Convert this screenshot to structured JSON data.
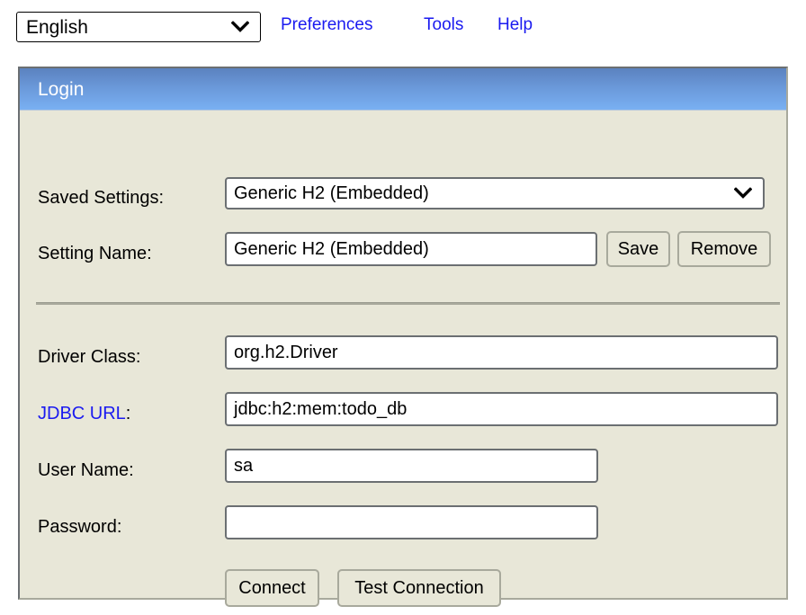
{
  "toolbar": {
    "language_select": {
      "value": "English",
      "arrow_icon": "chevron-down-icon"
    },
    "links": [
      {
        "label": "Preferences"
      },
      {
        "label": "Tools"
      },
      {
        "label": "Help"
      }
    ]
  },
  "panel": {
    "header_title": "Login",
    "accent_color": "#6a98d9",
    "background_color": "#e8e7d8",
    "link_color": "#1a1af0",
    "fields": {
      "saved_settings": {
        "label": "Saved Settings:",
        "value": "Generic H2 (Embedded)",
        "arrow_icon": "chevron-down-icon"
      },
      "setting_name": {
        "label": "Setting Name:",
        "value": "Generic H2 (Embedded)",
        "placeholder": ""
      },
      "driver_class": {
        "label": "Driver Class:",
        "value": "org.h2.Driver",
        "placeholder": ""
      },
      "jdbc_url": {
        "label": "JDBC URL",
        "label_colon": ":",
        "value": "jdbc:h2:mem:todo_db",
        "placeholder": ""
      },
      "user_name": {
        "label": "User Name:",
        "value": "sa",
        "placeholder": ""
      },
      "password": {
        "label": "Password:",
        "value": "",
        "placeholder": ""
      }
    },
    "buttons": {
      "save": "Save",
      "remove": "Remove",
      "connect": "Connect",
      "test_connection": "Test Connection"
    }
  }
}
